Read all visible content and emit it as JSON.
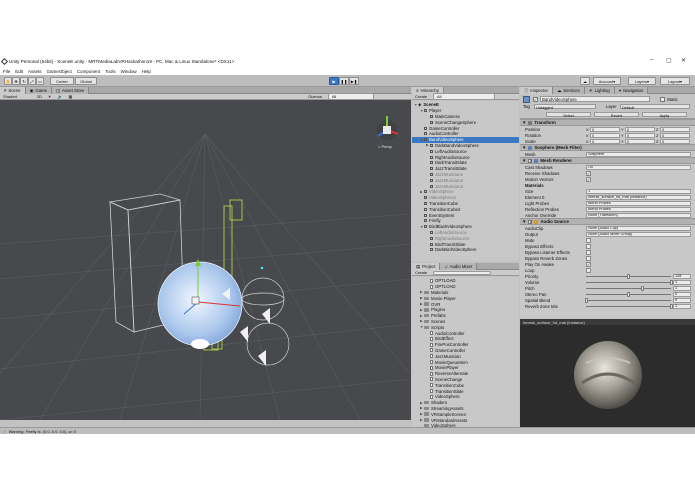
{
  "window": {
    "title": "Unity Personal (64bit) - SceneE.unity - MRTMediaLabVRHackathon19 - PC, Mac & Linux Standalone* <DX11>"
  },
  "menu": [
    "File",
    "Edit",
    "Assets",
    "GameObject",
    "Component",
    "Tools",
    "Window",
    "Help"
  ],
  "toolbar": {
    "pivot_label": "Center",
    "space_label": "Global",
    "account_label": "Account",
    "layers_label": "Layers",
    "layout_label": "Layout"
  },
  "scene_panel": {
    "tabs": [
      "Scene",
      "Game",
      "Asset Store"
    ],
    "shading_mode": "Shaded",
    "mode_2d": "2D",
    "gizmos_label": "Gizmos",
    "search_placeholder": "All",
    "persp_label": "< Persp"
  },
  "hierarchy": {
    "tab": "Hierarchy",
    "create_label": "Create",
    "search_placeholder": "All",
    "rows": [
      {
        "label": "SceneE",
        "indent": 0,
        "arrow": "▼",
        "style": "scene"
      },
      {
        "label": "Player",
        "indent": 1,
        "arrow": "▼",
        "style": ""
      },
      {
        "label": "MainCamera",
        "indent": 2,
        "arrow": "",
        "style": ""
      },
      {
        "label": "SceneChangeSphere",
        "indent": 2,
        "arrow": "",
        "style": ""
      },
      {
        "label": "GameController",
        "indent": 1,
        "arrow": "",
        "style": ""
      },
      {
        "label": "AudioController",
        "indent": 1,
        "arrow": "",
        "style": ""
      },
      {
        "label": "BandVideoSphere",
        "indent": 1,
        "arrow": "▼",
        "style": "sel"
      },
      {
        "label": "DarkBandVideoSphere",
        "indent": 2,
        "arrow": "▶",
        "style": ""
      },
      {
        "label": "LeftAudioSource",
        "indent": 2,
        "arrow": "",
        "style": ""
      },
      {
        "label": "RightAudioSource",
        "indent": 2,
        "arrow": "",
        "style": ""
      },
      {
        "label": "DarkTransitSlate",
        "indent": 2,
        "arrow": "",
        "style": ""
      },
      {
        "label": "JazzTransitSlate",
        "indent": 2,
        "arrow": "",
        "style": ""
      },
      {
        "label": "JazzMusician1",
        "indent": 2,
        "arrow": "",
        "style": "dim"
      },
      {
        "label": "JazzMusician2",
        "indent": 2,
        "arrow": "",
        "style": "dim"
      },
      {
        "label": "JazzMusician3",
        "indent": 2,
        "arrow": "",
        "style": "dim"
      },
      {
        "label": "VideoSphere",
        "indent": 1,
        "arrow": "▶",
        "style": "dim"
      },
      {
        "label": "VideoSphere2",
        "indent": 1,
        "arrow": "",
        "style": "dim"
      },
      {
        "label": "TransitionCube",
        "indent": 1,
        "arrow": "",
        "style": ""
      },
      {
        "label": "TransitionCube2",
        "indent": 1,
        "arrow": "",
        "style": ""
      },
      {
        "label": "EventSystem",
        "indent": 1,
        "arrow": "",
        "style": ""
      },
      {
        "label": "Firefly",
        "indent": 1,
        "arrow": "",
        "style": ""
      },
      {
        "label": "BirdBlackVideoSphere",
        "indent": 1,
        "arrow": "▼",
        "style": ""
      },
      {
        "label": "LeftAudioSource",
        "indent": 2,
        "arrow": "",
        "style": "dim"
      },
      {
        "label": "RightAudioSource",
        "indent": 2,
        "arrow": "",
        "style": "dim"
      },
      {
        "label": "BirdTransitSlate",
        "indent": 2,
        "arrow": "",
        "style": ""
      },
      {
        "label": "DarkBirdVideoSphere",
        "indent": 2,
        "arrow": "",
        "style": ""
      }
    ]
  },
  "project": {
    "tabs": [
      "Project",
      "Audio Mixer"
    ],
    "create_label": "Create",
    "rows": [
      {
        "label": "OPTLOAD",
        "indent": 2,
        "arrow": "",
        "style": "file"
      },
      {
        "label": "OPTLOAD",
        "indent": 2,
        "arrow": "",
        "style": "file"
      },
      {
        "label": "Materials",
        "indent": 1,
        "arrow": "▶",
        "style": "folder"
      },
      {
        "label": "Movie Player",
        "indent": 1,
        "arrow": "▶",
        "style": "folder"
      },
      {
        "label": "OVR",
        "indent": 1,
        "arrow": "▶",
        "style": "folder"
      },
      {
        "label": "Plugins",
        "indent": 1,
        "arrow": "▶",
        "style": "folder"
      },
      {
        "label": "Prefabs",
        "indent": 1,
        "arrow": "▶",
        "style": "folder"
      },
      {
        "label": "Scenes",
        "indent": 1,
        "arrow": "▶",
        "style": "folder"
      },
      {
        "label": "Scripts",
        "indent": 1,
        "arrow": "▼",
        "style": "folder"
      },
      {
        "label": "AudioController",
        "indent": 2,
        "arrow": "",
        "style": "file"
      },
      {
        "label": "BirdEffect",
        "indent": 2,
        "arrow": "",
        "style": "file"
      },
      {
        "label": "FirePosController",
        "indent": 2,
        "arrow": "",
        "style": "file"
      },
      {
        "label": "GameController",
        "indent": 2,
        "arrow": "",
        "style": "file"
      },
      {
        "label": "JazzMusician",
        "indent": 2,
        "arrow": "",
        "style": "file"
      },
      {
        "label": "MovieQueueItem",
        "indent": 2,
        "arrow": "",
        "style": "file"
      },
      {
        "label": "MoviePlayer",
        "indent": 2,
        "arrow": "",
        "style": "file"
      },
      {
        "label": "ReverseAlternate",
        "indent": 2,
        "arrow": "",
        "style": "file"
      },
      {
        "label": "SceneChange",
        "indent": 2,
        "arrow": "",
        "style": "file"
      },
      {
        "label": "TransitionCube",
        "indent": 2,
        "arrow": "",
        "style": "file"
      },
      {
        "label": "TransitionSlate",
        "indent": 2,
        "arrow": "",
        "style": "file"
      },
      {
        "label": "VideoSphere",
        "indent": 2,
        "arrow": "",
        "style": "file"
      },
      {
        "label": "Shaders",
        "indent": 1,
        "arrow": "▶",
        "style": "folder"
      },
      {
        "label": "StreamingAssets",
        "indent": 1,
        "arrow": "▶",
        "style": "folder"
      },
      {
        "label": "VRSampleScenes",
        "indent": 1,
        "arrow": "▶",
        "style": "folder"
      },
      {
        "label": "VRStandardAssets",
        "indent": 1,
        "arrow": "▶",
        "style": "folder"
      },
      {
        "label": "VideoSphere",
        "indent": 1,
        "arrow": "",
        "style": "folder"
      }
    ]
  },
  "inspector": {
    "tabs": [
      "Inspector",
      "Services",
      "Lighting",
      "Navigation"
    ],
    "object_name": "BandVideoSphere",
    "static_label": "Static",
    "tag_label": "Tag",
    "tag_value": "Untagged",
    "layer_label": "Layer",
    "layer_value": "Default",
    "prefab_buttons": [
      "Select",
      "Revert",
      "Apply"
    ],
    "transform": {
      "header": "Transform",
      "rows": [
        {
          "label": "Position",
          "x": "0",
          "y": "0",
          "z": "0"
        },
        {
          "label": "Rotation",
          "x": "0",
          "y": "0",
          "z": "0"
        },
        {
          "label": "Scale",
          "x": "0",
          "y": "0",
          "z": "0"
        }
      ]
    },
    "mesh_filter": {
      "header": "Sosphere (Mesh Filter)",
      "mesh_label": "Mesh",
      "mesh_value": "Sosphere"
    },
    "mesh_renderer": {
      "header": "Mesh Renderer",
      "rows": [
        {
          "label": "Cast Shadows",
          "kind": "field",
          "value": "On"
        },
        {
          "label": "Receive Shadows",
          "kind": "check",
          "value": "✓"
        },
        {
          "label": "Motion Vectors",
          "kind": "check",
          "value": "✓"
        },
        {
          "label": "Materials",
          "kind": "head",
          "value": ""
        },
        {
          "label": "Size",
          "kind": "field",
          "value": "1"
        },
        {
          "label": "Element 0",
          "kind": "field",
          "value": "Inmrsk_surface_hd_mat (Instance)"
        },
        {
          "label": "Light Probes",
          "kind": "field",
          "value": "Blend Probes"
        },
        {
          "label": "Reflection Probes",
          "kind": "field",
          "value": "Blend Probes"
        },
        {
          "label": "Anchor Override",
          "kind": "field",
          "value": "None (Transform)"
        }
      ]
    },
    "audio_source": {
      "header": "Audio Source",
      "rows": [
        {
          "label": "AudioClip",
          "kind": "field",
          "value": "None (Audio Clip)"
        },
        {
          "label": "Output",
          "kind": "field",
          "value": "None (Audio Mixer Group)"
        },
        {
          "label": "Mute",
          "kind": "check",
          "value": ""
        },
        {
          "label": "Bypass Effects",
          "kind": "check",
          "value": ""
        },
        {
          "label": "Bypass Listener Effects",
          "kind": "check",
          "value": ""
        },
        {
          "label": "Bypass Reverb Zones",
          "kind": "check",
          "value": ""
        },
        {
          "label": "Play On Awake",
          "kind": "check",
          "value": "✓"
        },
        {
          "label": "Loop",
          "kind": "check",
          "value": ""
        }
      ],
      "sliders": [
        {
          "label": "Priority",
          "value": "128",
          "fraction": 0.5,
          "low": "High",
          "high": "Low"
        },
        {
          "label": "Volume",
          "value": "1",
          "fraction": 1.0,
          "low": "",
          "high": ""
        },
        {
          "label": "Pitch",
          "value": "1",
          "fraction": 0.67,
          "low": "",
          "high": ""
        },
        {
          "label": "Stereo Pan",
          "value": "0",
          "fraction": 0.5,
          "low": "Left",
          "high": "Right"
        },
        {
          "label": "Spatial Blend",
          "value": "0",
          "fraction": 0.0,
          "low": "2D",
          "high": "3D"
        },
        {
          "label": "Reverb Zone Mix",
          "value": "1",
          "fraction": 1.0,
          "low": "",
          "high": ""
        }
      ]
    },
    "preview_label": "Inmrsk_surface_hd_mat (Instance)"
  },
  "status": {
    "text": "Warning: Firefly is: (0.0, 0.0, 0.0), w: 0"
  }
}
